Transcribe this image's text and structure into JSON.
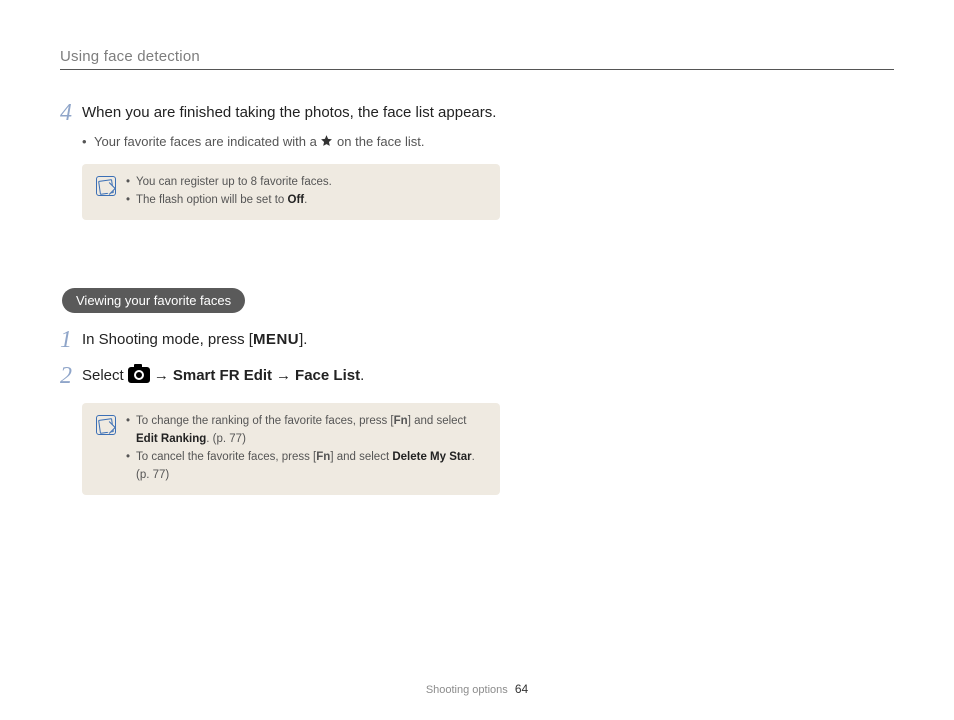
{
  "header": {
    "title": "Using face detection"
  },
  "step4": {
    "num": "4",
    "text": "When you are finished taking the photos, the face list appears.",
    "bullet_pre": "Your favorite faces are indicated with a ",
    "bullet_post": " on the face list."
  },
  "note1": {
    "items": [
      {
        "pre": "You can register up to 8 favorite faces."
      },
      {
        "pre": "The flash option will be set to ",
        "bold": "Off",
        "post": "."
      }
    ]
  },
  "pill": {
    "label": "Viewing your favorite faces"
  },
  "step1": {
    "num": "1",
    "pre": "In Shooting mode, press [",
    "menu": "MENU",
    "post": "]."
  },
  "step2": {
    "num": "2",
    "pre": "Select ",
    "arrow": "→",
    "b1": "Smart FR Edit",
    "b2": "Face List",
    "post": "."
  },
  "note2": {
    "items": [
      {
        "pre": "To change the ranking of the favorite faces, press [",
        "fn": "Fn",
        "mid": "] and select ",
        "bold": "Edit Ranking",
        "post": ". (p. 77)"
      },
      {
        "pre": "To cancel the favorite faces, press [",
        "fn": "Fn",
        "mid": "] and select ",
        "bold": "Delete My Star",
        "post": ". (p. 77)"
      }
    ]
  },
  "footer": {
    "section": "Shooting options",
    "page": "64"
  }
}
